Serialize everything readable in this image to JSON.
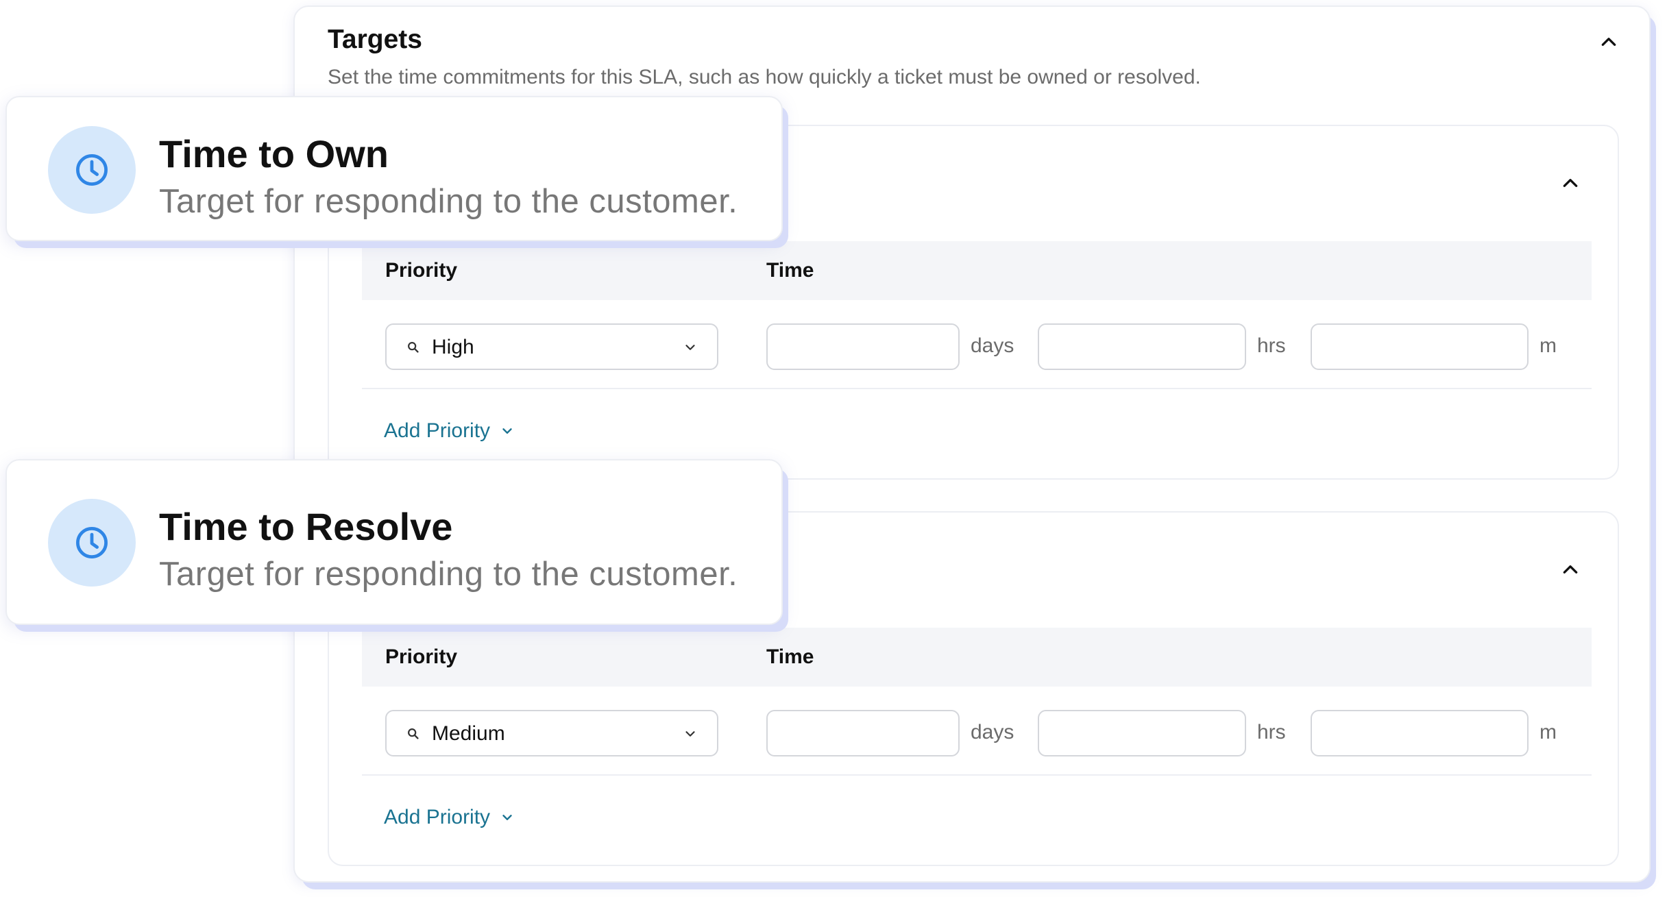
{
  "targets": {
    "title": "Targets",
    "description": "Set the time commitments for this SLA, such as how quickly a ticket must be owned or resolved."
  },
  "sections": [
    {
      "columns": {
        "priority": "Priority",
        "time": "Time"
      },
      "row": {
        "priority_value": "High",
        "days_value": "",
        "hrs_value": "",
        "mins_value": ""
      },
      "units": {
        "days": "days",
        "hrs": "hrs",
        "m": "m"
      },
      "add_priority": "Add Priority"
    },
    {
      "columns": {
        "priority": "Priority",
        "time": "Time"
      },
      "row": {
        "priority_value": "Medium",
        "days_value": "",
        "hrs_value": "",
        "mins_value": ""
      },
      "units": {
        "days": "days",
        "hrs": "hrs",
        "m": "m"
      },
      "add_priority": "Add Priority"
    }
  ],
  "callouts": [
    {
      "title": "Time to Own",
      "subtitle": "Target for responding to the customer.",
      "icon": "clock-icon"
    },
    {
      "title": "Time to Resolve",
      "subtitle": "Target for responding to the customer.",
      "icon": "clock-icon"
    }
  ],
  "colors": {
    "accent_link": "#1a7391",
    "clock_badge_bg": "#d6e8fb",
    "clock_stroke": "#2f86e6",
    "shadow_lavender": "#d7dcf9"
  }
}
